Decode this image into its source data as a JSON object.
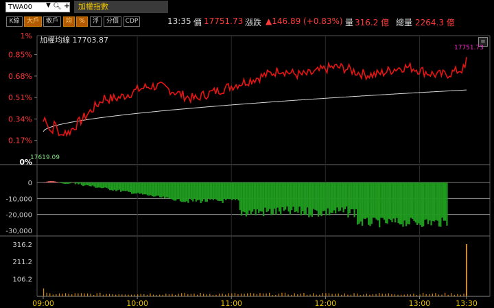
{
  "topbar": {
    "symbol": "TWA00",
    "symbol_dropdown_icon": "chevron-down-icon",
    "search_icon": "search-icon",
    "add_icon": "plus-icon",
    "index_title": "加權指數"
  },
  "toolbar": {
    "buttons": [
      "K線",
      "大戶",
      "散戶",
      "均",
      "%",
      "浮",
      "分價",
      "CDP"
    ],
    "active": [
      "大戶",
      "均",
      "%"
    ],
    "time": "13:35",
    "price_label": "價",
    "price": "17751.73",
    "change_label": "漲跌",
    "change": "▲146.89 (+0.83%)",
    "volume_label": "量",
    "volume": "316.2 億",
    "total_volume_label": "總量",
    "total_volume": "2264.3 億"
  },
  "price_chart": {
    "avg_label": "加權均線 17703.87",
    "last_price_label": "17751.73",
    "open_label": "17619.09",
    "y_ticks": [
      "1%",
      "0.85%",
      "0.68%",
      "0.51%",
      "0.34%",
      "0.17%",
      "0%"
    ],
    "y_values": [
      1,
      0.85,
      0.68,
      0.51,
      0.34,
      0.17,
      0
    ]
  },
  "force_chart": {
    "y_ticks": [
      "0",
      "-10,000",
      "-20,000",
      "-30,000"
    ],
    "y_values": [
      0,
      -10000,
      -20000,
      -30000
    ]
  },
  "volume_chart": {
    "y_ticks": [
      "316.2",
      "211.2",
      "106.2"
    ],
    "y_values": [
      316.2,
      211.2,
      106.2
    ]
  },
  "x_axis": {
    "ticks": [
      "09:00",
      "10:00",
      "11:00",
      "12:00",
      "13:00",
      "13:30"
    ]
  },
  "colors": {
    "price_line": "#e81414",
    "avg_line": "#d8d8d8",
    "positive_bar": "#e86060",
    "negative_bar": "#1f9a1f",
    "volume_bar": "#d98a00",
    "axis_text_red": "#ff3b3b",
    "open_label": "#7fe07f",
    "last_label": "#ff2bd0"
  }
}
